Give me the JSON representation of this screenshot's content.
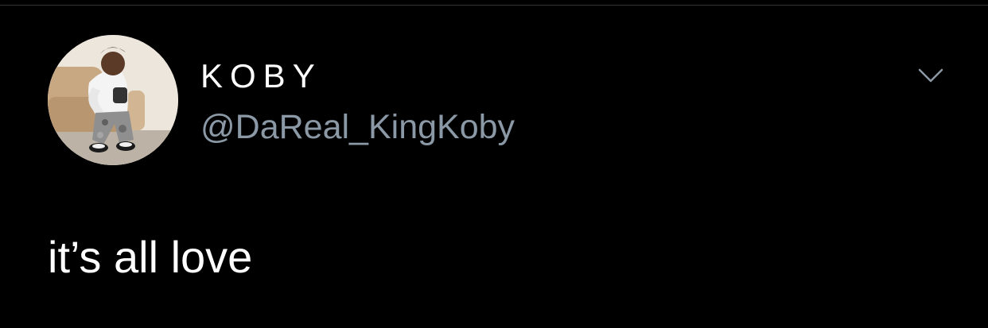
{
  "tweet": {
    "author": {
      "display_name": "KOBY",
      "handle": "@DaReal_KingKoby",
      "avatar": "profile-photo"
    },
    "text": "it’s all love",
    "menu_icon": "chevron-down-icon"
  },
  "colors": {
    "background": "#000000",
    "primary_text": "#ffffff",
    "secondary_text": "#8b98a5",
    "divider": "#2f3336"
  }
}
